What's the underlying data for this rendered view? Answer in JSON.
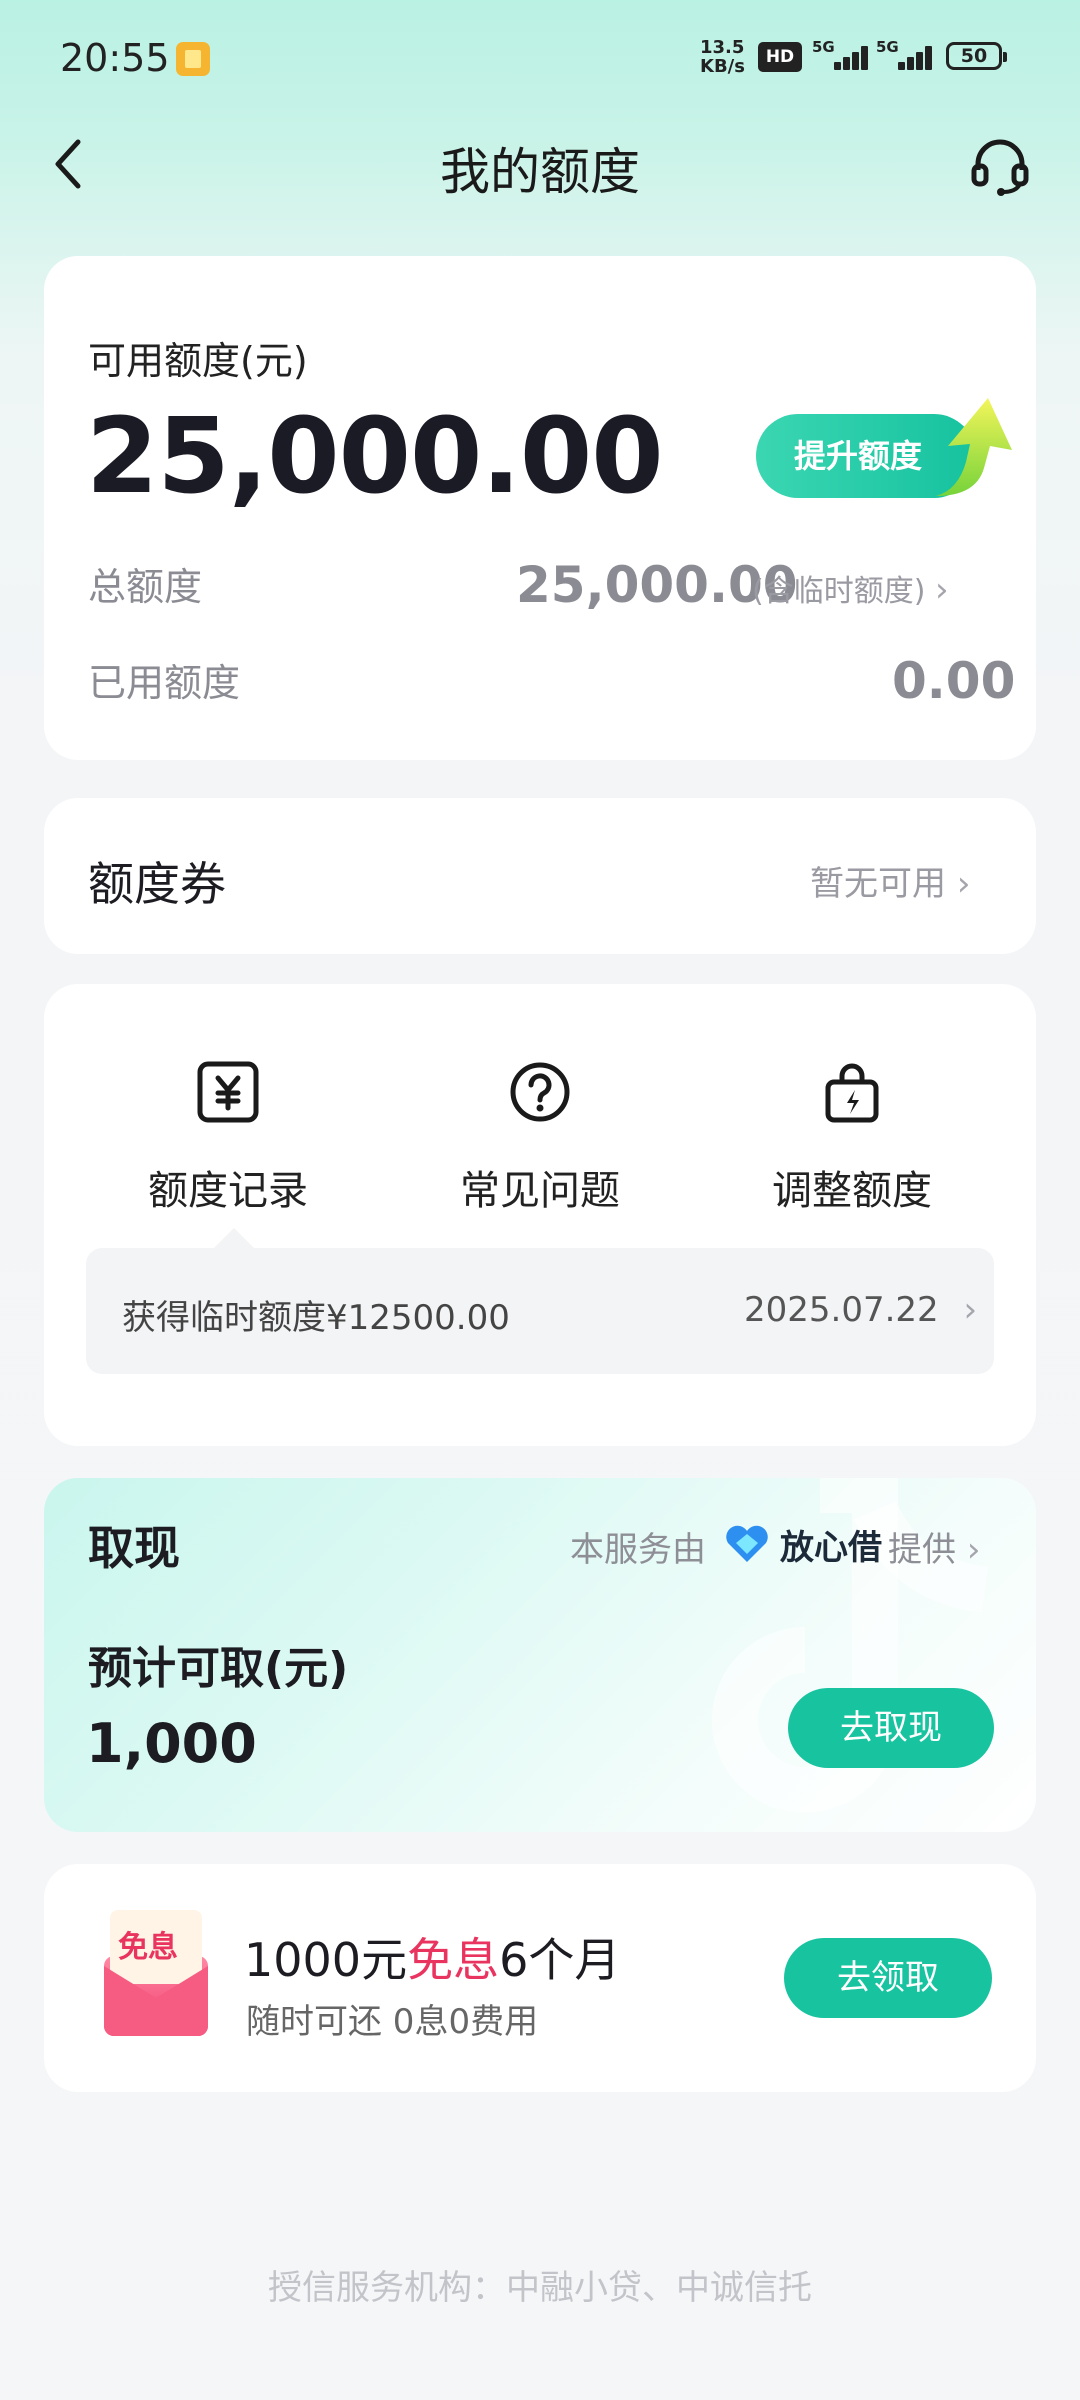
{
  "status_bar": {
    "time": "20:55",
    "net_speed_value": "13.5",
    "net_speed_unit": "KB/s",
    "hd_badge": "HD",
    "signal_1": "5G",
    "signal_2": "5G",
    "battery": "50"
  },
  "header": {
    "title": "我的额度"
  },
  "limit_card": {
    "available_label": "可用额度(元)",
    "available_value": "25,000.00",
    "raise_button": "提升额度",
    "total_label": "总额度",
    "total_value": "25,000.00",
    "total_note": "(含临时额度)",
    "used_label": "已用额度",
    "used_value": "0.00"
  },
  "coupon": {
    "label": "额度券",
    "status": "暂无可用"
  },
  "entries": [
    {
      "label": "额度记录",
      "icon": "yuan-receipt-icon"
    },
    {
      "label": "常见问题",
      "icon": "question-circle-icon"
    },
    {
      "label": "调整额度",
      "icon": "bag-lightning-icon"
    }
  ],
  "record_note": {
    "text": "获得临时额度¥12500.00",
    "date": "2025.07.22"
  },
  "cash": {
    "title": "取现",
    "provider_prefix": "本服务由",
    "provider_name": "放心借",
    "provider_suffix": "提供",
    "estimate_label": "预计可取(元)",
    "estimate_value": "1,000",
    "button": "去取现"
  },
  "promo": {
    "badge": "免息",
    "title_part1": "1000元",
    "title_highlight": "免息",
    "title_part2": "6个月",
    "subtitle": "随时可还 0息0费用",
    "button": "去领取"
  },
  "footer": "授信服务机构：中融小贷、中诚信托",
  "colors": {
    "accent": "#18c3a0",
    "highlight": "#e8345e"
  }
}
